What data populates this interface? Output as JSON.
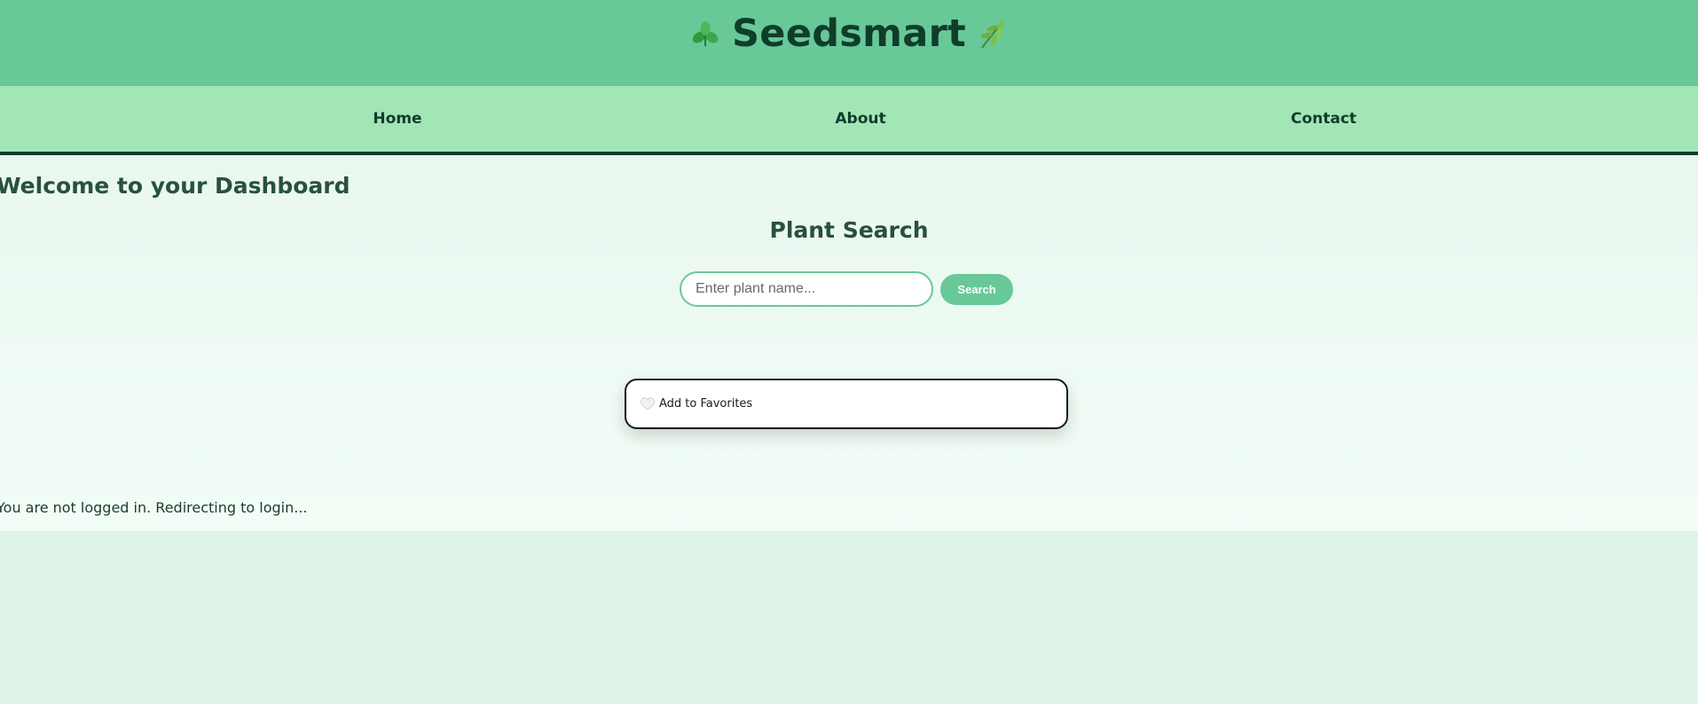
{
  "header": {
    "title": "Seedsmart",
    "left_icon": "clover-leaf-icon",
    "right_icon": "herb-sprig-icon"
  },
  "nav": {
    "items": [
      {
        "label": "Home"
      },
      {
        "label": "About"
      },
      {
        "label": "Contact"
      }
    ]
  },
  "main": {
    "welcome": "Welcome to your Dashboard",
    "search": {
      "title": "Plant Search",
      "placeholder": "Enter plant name...",
      "value": "",
      "button_label": "Search"
    },
    "favorites": {
      "icon": "heart-icon",
      "label": "Add to Favorites"
    },
    "status": "You are not logged in. Redirecting to login..."
  },
  "colors": {
    "header_bg": "#68c898",
    "nav_bg": "#a2e6b6",
    "accent_dark": "#0f3d2a",
    "heading_text": "#285040",
    "button_bg": "#68c898",
    "page_bg": "#e0f3e8"
  }
}
